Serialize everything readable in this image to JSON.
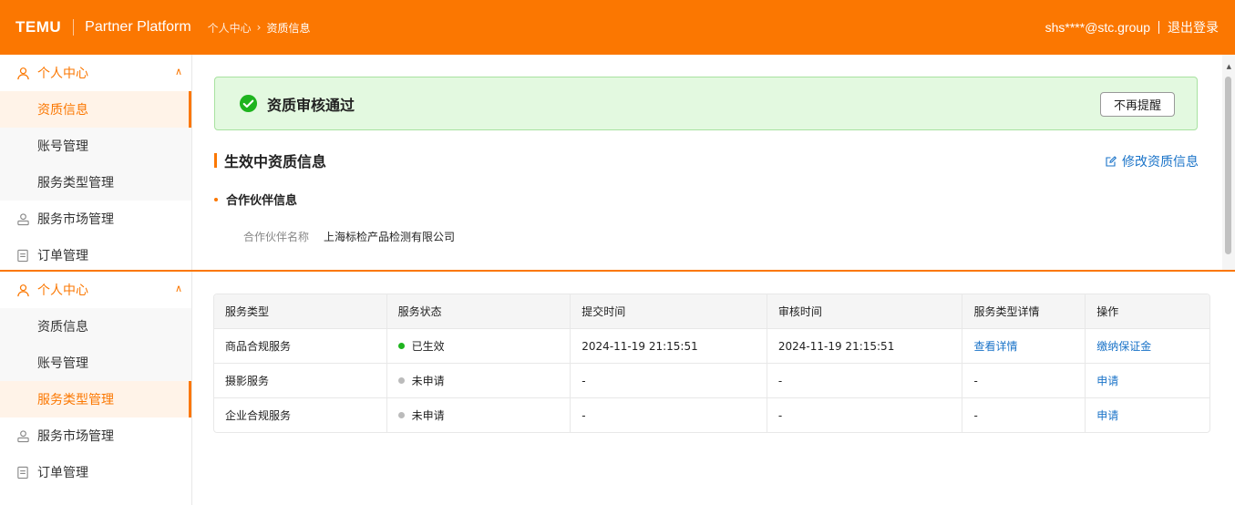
{
  "header": {
    "logo": "TEMU",
    "platform": "Partner Platform",
    "breadcrumb": [
      "个人中心",
      "资质信息"
    ],
    "user": "shs****@stc.group",
    "logout": "退出登录"
  },
  "sidebar_top": {
    "group": "个人中心",
    "subs": [
      "资质信息",
      "账号管理",
      "服务类型管理"
    ],
    "active": "资质信息",
    "items": [
      "服务市场管理",
      "订单管理"
    ]
  },
  "sidebar_bottom": {
    "group": "个人中心",
    "subs": [
      "资质信息",
      "账号管理",
      "服务类型管理"
    ],
    "active": "服务类型管理",
    "items": [
      "服务市场管理",
      "订单管理"
    ]
  },
  "banner": {
    "text": "资质审核通过",
    "dismiss": "不再提醒"
  },
  "section": {
    "title": "生效中资质信息",
    "edit": "修改资质信息",
    "subtitle": "合作伙伴信息",
    "field_label": "合作伙伴名称",
    "field_value": "上海标检产品检测有限公司"
  },
  "table": {
    "headers": [
      "服务类型",
      "服务状态",
      "提交时间",
      "审核时间",
      "服务类型详情",
      "操作"
    ],
    "rows": [
      {
        "type": "商品合规服务",
        "status": "已生效",
        "status_color": "#1fb41f",
        "submit": "2024-11-19 21:15:51",
        "review": "2024-11-19 21:15:51",
        "detail": "查看详情",
        "action": "缴纳保证金"
      },
      {
        "type": "摄影服务",
        "status": "未申请",
        "status_color": "#bbbbbb",
        "submit": "-",
        "review": "-",
        "detail": "-",
        "action": "申请"
      },
      {
        "type": "企业合规服务",
        "status": "未申请",
        "status_color": "#bbbbbb",
        "submit": "-",
        "review": "-",
        "detail": "-",
        "action": "申请"
      }
    ]
  },
  "colors": {
    "accent": "#fb7701",
    "link": "#1a73c8",
    "success": "#1fb41f"
  }
}
